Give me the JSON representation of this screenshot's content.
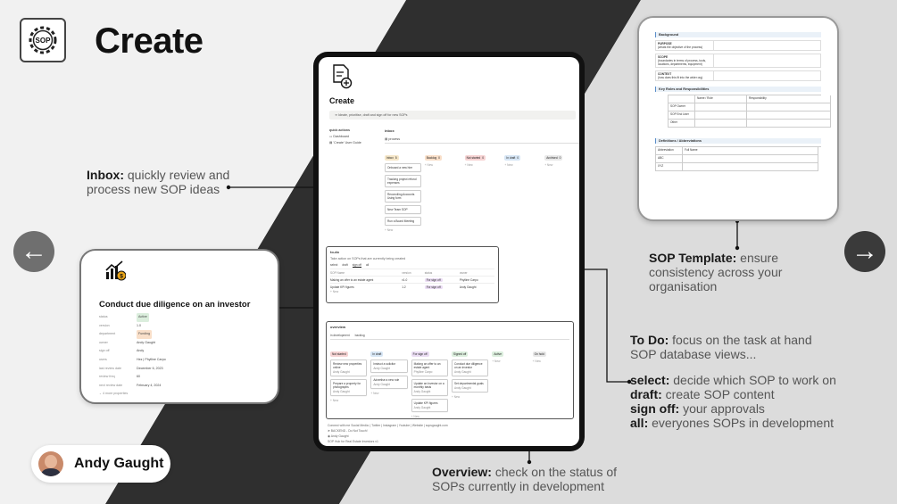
{
  "title": "Create",
  "logo_text": "SOP",
  "nav": {
    "prev_icon": "←",
    "next_icon": "→"
  },
  "author_name": "Andy Gaught",
  "callouts": {
    "inbox": {
      "bold": "Inbox:",
      "text": " quickly review and process new SOP ideas"
    },
    "template": {
      "bold": "SOP Template:",
      "text": " ensure consistency across your organisation"
    },
    "todo": {
      "bold": "To Do:",
      "text": " focus on the task at hand",
      "line2": "SOP database views...",
      "views": [
        {
          "bold": "select:",
          "text": " decide which SOP to work on"
        },
        {
          "bold": "draft:",
          "text": " create SOP content"
        },
        {
          "bold": "sign off:",
          "text": " your approvals"
        },
        {
          "bold": "all:",
          "text": " everyones SOPs in development"
        }
      ]
    },
    "overview": {
      "bold": "Overview:",
      "text": " check on the status of SOPs currently in development"
    }
  },
  "app": {
    "page_title": "Create",
    "banner": "Ideate, prioritise, draft and sign off for new SOPs",
    "quick_actions": {
      "heading": "quick actions",
      "items": [
        "Dashboard",
        "'Create' User Guide"
      ]
    },
    "inbox": {
      "heading": "inbox",
      "tab": "process",
      "columns": [
        {
          "label": "Inbox",
          "count": "5",
          "color": "#f5e6c8",
          "cards": [
            "Onboard a new hire",
            "Tracking project refund expenses",
            "Reconciling Accounts Using form",
            "New Team SOP",
            "Run a Board Meeting"
          ]
        },
        {
          "label": "Backlog",
          "count": "0",
          "color": "#f9dfc9",
          "cards": []
        },
        {
          "label": "Not started",
          "count": "0",
          "color": "#f6d3d3",
          "cards": []
        },
        {
          "label": "In draft",
          "count": "0",
          "color": "#d7e6f5",
          "cards": []
        },
        {
          "label": "Archived",
          "count": "0",
          "color": "#e8e8e8",
          "cards": []
        }
      ],
      "new_label": "+ New"
    },
    "todo": {
      "heading": "to-do",
      "subtitle": "Take action on SOPs that are currently being created",
      "tabs": [
        "select",
        "draft",
        "sign off",
        "all"
      ],
      "header": [
        "SOP Name",
        "version",
        "status",
        "owner"
      ],
      "rows": [
        {
          "name": "Making an offer to an estate agent",
          "version": "v1.0",
          "status": "For sign off",
          "owner": "Phylline Carpo"
        },
        {
          "name": "Update KPI figures",
          "version": "1.2",
          "status": "For sign off",
          "owner": "Andy Gaught"
        }
      ],
      "new_label": "+ New"
    },
    "overview": {
      "heading": "overview",
      "tabs": [
        "in development",
        "backlog"
      ],
      "columns": [
        {
          "label": "Not started",
          "color": "#f6d3d3",
          "cards": [
            {
              "t": "Review new properties online",
              "p": "Andy Gaught"
            },
            {
              "t": "Prepare a property for photographs",
              "p": "Andy Gaught"
            }
          ]
        },
        {
          "label": "In draft",
          "color": "#d7e6f5",
          "cards": [
            {
              "t": "Instruct a solicitor",
              "p": "Andy Gaught"
            },
            {
              "t": "Advertise a new role",
              "p": "Andy Gaught"
            }
          ]
        },
        {
          "label": "For sign off",
          "color": "#eadcf3",
          "cards": [
            {
              "t": "Making an offer to an estate agent",
              "p": "Phylline Carpo"
            },
            {
              "t": "Update an Investor on a monthly basis",
              "p": "Andy Gaught"
            },
            {
              "t": "Update KPI figures",
              "p": "Andy Gaught"
            }
          ]
        },
        {
          "label": "Signed off",
          "color": "#dbeedd",
          "cards": [
            {
              "t": "Conduct due diligence on an investor",
              "p": "Andy Gaught"
            },
            {
              "t": "Set departmental goals",
              "p": "Andy Gaught"
            }
          ]
        },
        {
          "label": "Active",
          "color": "#dbeedd",
          "cards": []
        },
        {
          "label": "On hold",
          "color": "#e8e8e8",
          "cards": []
        }
      ],
      "new_label": "+ New"
    },
    "footer": {
      "social": "Connect with me Social Media: | Twitter | Instagram | Youtube | Website | sopsgaught.com",
      "backend": "BACKEND - Do Not Touch!",
      "credit": "Andy Gaught",
      "hub": "SOP Hub for Real Estate Investors v1"
    }
  },
  "template_doc": {
    "background_heading": "Background",
    "fields": [
      {
        "label": "PURPOSE",
        "hint": "(whats the objective of the process)"
      },
      {
        "label": "SCOPE",
        "hint": "(boundaries in terms of process, tools, locations, departments, equipment)"
      },
      {
        "label": "CONTEXT",
        "hint": "(how does this fit into the wider org)"
      }
    ],
    "roles_heading": "Key Roles and Responsibilities",
    "roles_cols": [
      "",
      "Name / Role",
      "Responsibility"
    ],
    "roles_rows": [
      "SOP Owner",
      "SOP End User",
      "Other"
    ],
    "defs_heading": "Definitions / Abbreviations",
    "defs_cols": [
      "Abbreviation",
      "Full Name"
    ],
    "defs_rows": [
      "ABC",
      "XYZ"
    ]
  },
  "entry_card": {
    "title": "Conduct due diligence on an investor",
    "props": [
      {
        "k": "status",
        "v": "Active",
        "tag": "#dbeedd"
      },
      {
        "k": "version",
        "v": "1.0"
      },
      {
        "k": "department",
        "v": "Funding",
        "tag": "#f9dfc9"
      },
      {
        "k": "owner",
        "v": "Andy Gaught"
      },
      {
        "k": "sign off",
        "v": "Andy"
      },
      {
        "k": "users",
        "v": "Hez | Phylline Carpo"
      },
      {
        "k": "last review date",
        "v": "December 6, 2023"
      },
      {
        "k": "review freq",
        "v": "60"
      },
      {
        "k": "next review date",
        "v": "February 4, 2024"
      }
    ],
    "more": "4 more properties"
  }
}
